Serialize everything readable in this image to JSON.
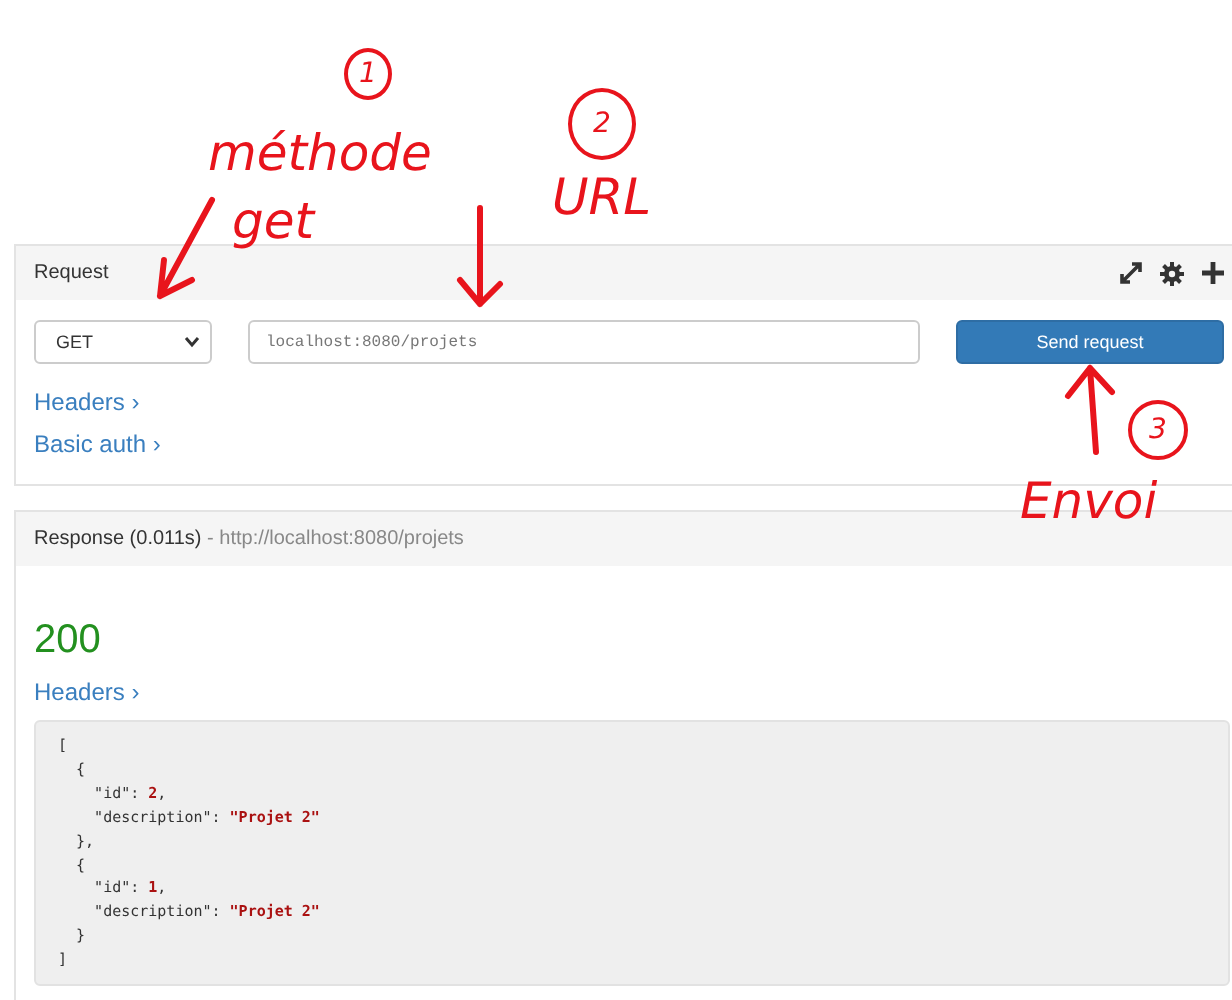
{
  "annotations": [
    {
      "kind": "circled",
      "text": "1"
    },
    {
      "kind": "note",
      "text": "méthode"
    },
    {
      "kind": "note",
      "text": "get"
    },
    {
      "kind": "circled",
      "text": "2"
    },
    {
      "kind": "note",
      "text": "URL"
    },
    {
      "kind": "circled",
      "text": "3"
    },
    {
      "kind": "note",
      "text": "Envoi"
    }
  ],
  "request": {
    "title": "Request",
    "method": "GET",
    "url": "localhost:8080/projets",
    "send_button": "Send request",
    "links": [
      "Headers ›",
      "Basic auth ›"
    ]
  },
  "response": {
    "title": "Response (0.011s)",
    "separator": " - ",
    "url": "http://localhost:8080/projets",
    "status": "200",
    "links": [
      "Headers ›"
    ],
    "body_lines": [
      {
        "code": "["
      },
      {
        "code": "  {"
      },
      {
        "code": "    \"id\": ",
        "value": "2",
        "suffix": ","
      },
      {
        "code": "    \"description\": ",
        "value": "\"Projet 2\""
      },
      {
        "code": "  },"
      },
      {
        "code": "  {"
      },
      {
        "code": "    \"id\": ",
        "value": "1",
        "suffix": ","
      },
      {
        "code": "    \"description\": ",
        "value": "\"Projet 2\""
      },
      {
        "code": "  }"
      },
      {
        "code": "]"
      }
    ]
  }
}
